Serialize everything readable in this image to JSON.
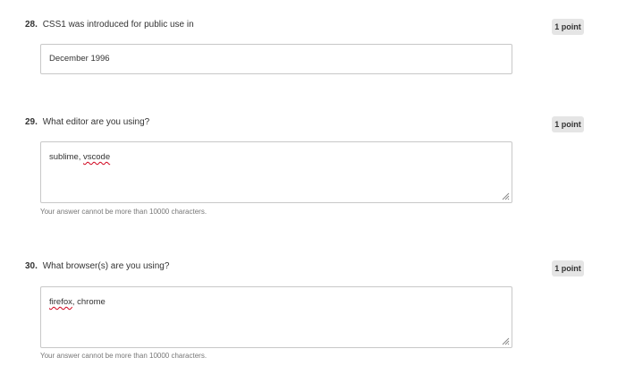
{
  "questions": [
    {
      "number": "28.",
      "text": "CSS1 was introduced for public use in",
      "points": "1 point",
      "answer": "December 1996"
    },
    {
      "number": "29.",
      "text": "What editor are you using?",
      "points": "1 point",
      "answer_plain": "sublime, ",
      "answer_flagged": "vscode",
      "helper": "Your answer cannot be more than 10000 characters."
    },
    {
      "number": "30.",
      "text": "What browser(s) are you using?",
      "points": "1 point",
      "answer_flagged": "firefox",
      "answer_plain": ", chrome",
      "helper": "Your answer cannot be more than 10000 characters."
    }
  ]
}
